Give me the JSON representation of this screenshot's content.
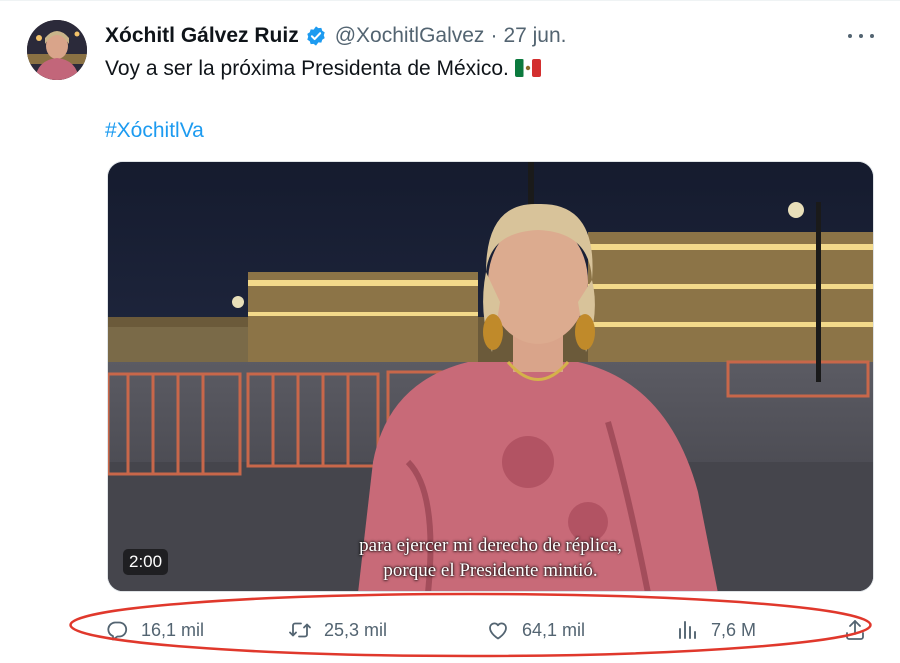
{
  "tweet": {
    "author_name": "Xóchitl Gálvez Ruiz",
    "handle": "@XochitlGalvez",
    "separator": "·",
    "date": "27 jun.",
    "text": "Voy a ser la próxima Presidenta de México.",
    "hashtag": "#XóchitlVa"
  },
  "media": {
    "duration": "2:00",
    "subtitle_line1": "para ejercer mi derecho de réplica,",
    "subtitle_line2": "porque el Presidente mintió."
  },
  "actions": {
    "replies": "16,1 mil",
    "retweets": "25,3 mil",
    "likes": "64,1 mil",
    "views": "7,6 M"
  },
  "colors": {
    "accent": "#1d9bf0",
    "secondary_text": "#536471",
    "annotation": "#e0382c"
  },
  "icons": [
    "verified-badge-icon",
    "more-icon",
    "mexico-flag-icon",
    "reply-icon",
    "retweet-icon",
    "like-icon",
    "views-icon",
    "share-icon"
  ]
}
